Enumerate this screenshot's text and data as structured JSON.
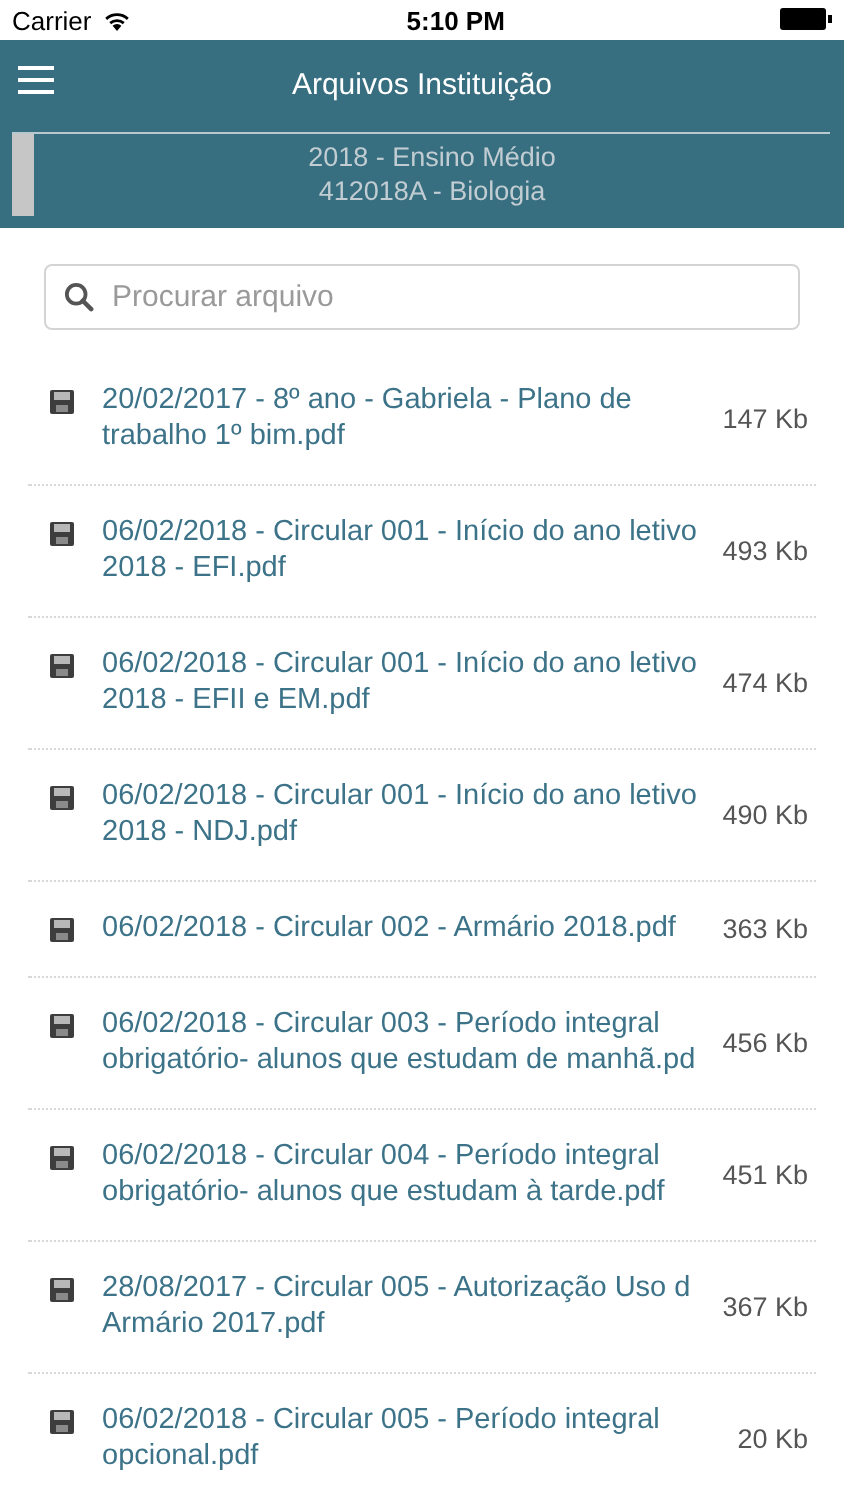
{
  "status_bar": {
    "carrier": "Carrier",
    "time": "5:10 PM"
  },
  "header": {
    "title": "Arquivos Instituição",
    "context": [
      "2018 - Ensino Médio",
      "412018A - Biologia"
    ]
  },
  "search": {
    "placeholder": "Procurar arquivo"
  },
  "files": [
    {
      "name": "20/02/2017 - 8º ano - Gabriela - Plano de trabalho 1º bim.pdf",
      "size": "147 Kb"
    },
    {
      "name": "06/02/2018 - Circular 001 - Início do ano letivo 2018 - EFI.pdf",
      "size": "493 Kb"
    },
    {
      "name": "06/02/2018 - Circular 001 - Início do ano letivo 2018 - EFII e EM.pdf",
      "size": "474 Kb"
    },
    {
      "name": "06/02/2018 - Circular 001 - Início do ano letivo 2018 - NDJ.pdf",
      "size": "490 Kb"
    },
    {
      "name": "06/02/2018 - Circular 002 - Armário 2018.pdf",
      "size": "363 Kb"
    },
    {
      "name": "06/02/2018 - Circular 003 - Período integral obrigatório- alunos que estudam de manhã.pd",
      "size": "456 Kb"
    },
    {
      "name": "06/02/2018 - Circular 004 - Período integral obrigatório- alunos que estudam à tarde.pdf",
      "size": "451 Kb"
    },
    {
      "name": "28/08/2017 - Circular 005 - Autorização Uso d Armário 2017.pdf",
      "size": "367 Kb"
    },
    {
      "name": "06/02/2018 - Circular 005 - Período integral opcional.pdf",
      "size": "20 Kb"
    }
  ]
}
